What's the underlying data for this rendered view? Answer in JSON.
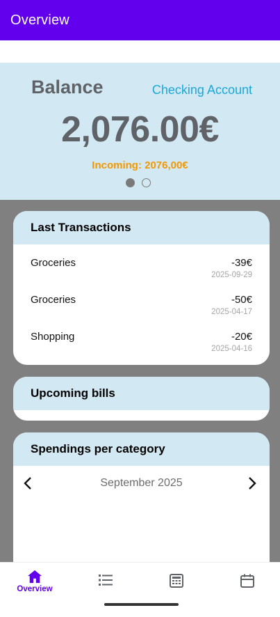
{
  "app_bar": {
    "title": "Overview"
  },
  "balance": {
    "title": "Balance",
    "account": "Checking Account",
    "amount": "2,076.00€",
    "incoming": "Incoming: 2076,00€",
    "pager": {
      "total": 2,
      "active": 1
    }
  },
  "last_transactions": {
    "title": "Last Transactions",
    "items": [
      {
        "name": "Groceries",
        "amount": "-39€",
        "date": "2025-09-29"
      },
      {
        "name": "Groceries",
        "amount": "-50€",
        "date": "2025-04-17"
      },
      {
        "name": "Shopping",
        "amount": "-20€",
        "date": "2025-04-16"
      }
    ]
  },
  "upcoming_bills": {
    "title": "Upcoming bills"
  },
  "spendings": {
    "title": "Spendings per category",
    "month": "September 2025"
  },
  "bottom_nav": {
    "items": [
      {
        "icon": "home-icon",
        "label": "Overview",
        "active": true
      },
      {
        "icon": "list-icon",
        "label": "",
        "active": false
      },
      {
        "icon": "calculator-icon",
        "label": "",
        "active": false
      },
      {
        "icon": "calendar-icon",
        "label": "",
        "active": false
      }
    ]
  },
  "colors": {
    "app_bar": "#6200ee",
    "panel": "#d2e8f3",
    "account": "#1ba8dc",
    "incoming": "#f29800",
    "background": "#808080"
  }
}
